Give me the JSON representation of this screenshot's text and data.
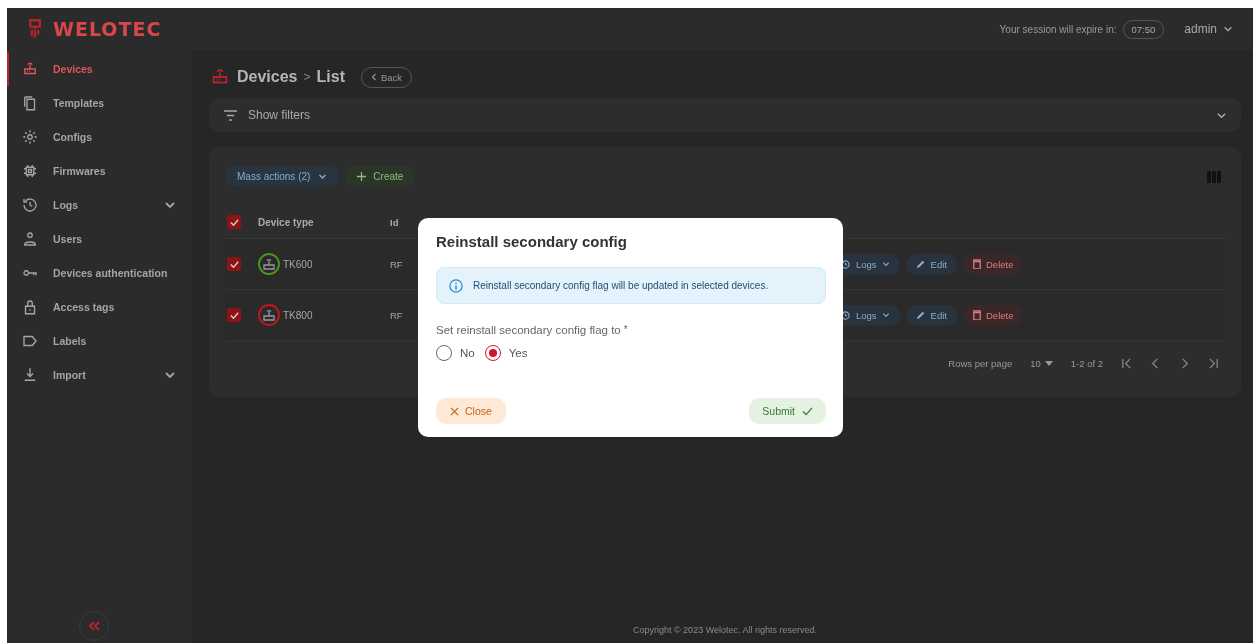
{
  "header": {
    "logo": "WELOTEC",
    "session_label": "Your session will expire in:",
    "session_time": "07:50",
    "user": "admin"
  },
  "sidebar": {
    "items": [
      {
        "label": "Devices",
        "selected": true,
        "expandable": false
      },
      {
        "label": "Templates",
        "selected": false,
        "expandable": false
      },
      {
        "label": "Configs",
        "selected": false,
        "expandable": false
      },
      {
        "label": "Firmwares",
        "selected": false,
        "expandable": false
      },
      {
        "label": "Logs",
        "selected": false,
        "expandable": true
      },
      {
        "label": "Users",
        "selected": false,
        "expandable": false
      },
      {
        "label": "Devices authentication",
        "selected": false,
        "expandable": false
      },
      {
        "label": "Access tags",
        "selected": false,
        "expandable": false
      },
      {
        "label": "Labels",
        "selected": false,
        "expandable": false
      },
      {
        "label": "Import",
        "selected": false,
        "expandable": true
      }
    ]
  },
  "page": {
    "title": "Devices",
    "separator": ">",
    "subtitle": "List",
    "back": "Back"
  },
  "filters": {
    "label": "Show filters"
  },
  "toolbar": {
    "mass_actions": "Mass actions (2)",
    "create": "Create"
  },
  "table": {
    "all_checked": true,
    "columns": [
      "Device type",
      "Id"
    ],
    "rows": [
      {
        "checked": true,
        "device_type": "TK600",
        "color": "#4c9a1e",
        "id": "RF",
        "actions": [
          "Logs",
          "Edit",
          "Delete"
        ]
      },
      {
        "checked": true,
        "device_type": "TK800",
        "color": "#c4161c",
        "id": "RF",
        "actions": [
          "Logs",
          "Edit",
          "Delete"
        ]
      }
    ],
    "pagination": {
      "rows_label": "Rows per page",
      "rows_value": "10",
      "range": "1-2 of 2"
    }
  },
  "footer": {
    "copyright": "Copyright © 2023 Welotec. All rights reserved."
  },
  "dialog": {
    "title": "Reinstall secondary config",
    "info": "Reinstall secondary config flag will be updated in selected devices.",
    "field_label": "Set reinstall secondary config flag to",
    "required_mark": "*",
    "options": [
      {
        "label": "No",
        "selected": false
      },
      {
        "label": "Yes",
        "selected": true
      }
    ],
    "close": "Close",
    "submit": "Submit"
  }
}
